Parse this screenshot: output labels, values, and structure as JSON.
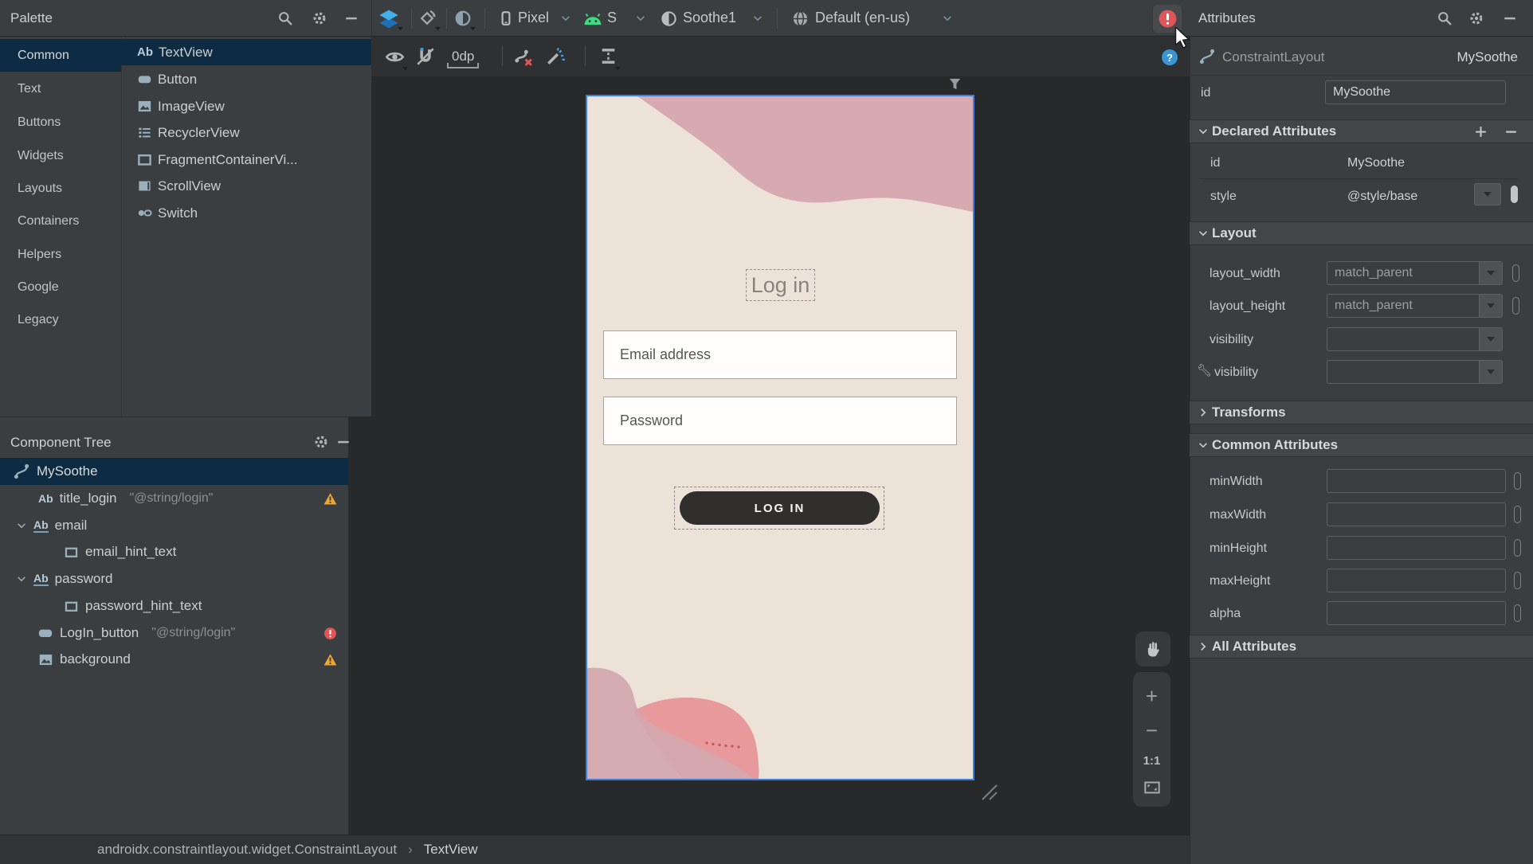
{
  "palette": {
    "title": "Palette",
    "categories": [
      {
        "label": "Common",
        "selected": true
      },
      {
        "label": "Text"
      },
      {
        "label": "Buttons"
      },
      {
        "label": "Widgets"
      },
      {
        "label": "Layouts"
      },
      {
        "label": "Containers"
      },
      {
        "label": "Helpers"
      },
      {
        "label": "Google"
      },
      {
        "label": "Legacy"
      }
    ],
    "widgets": [
      {
        "label": "TextView",
        "icon": "textview-ab-icon",
        "selected": true
      },
      {
        "label": "Button",
        "icon": "button-icon"
      },
      {
        "label": "ImageView",
        "icon": "image-icon"
      },
      {
        "label": "RecyclerView",
        "icon": "list-icon"
      },
      {
        "label": "FragmentContainerVi...",
        "icon": "fragment-icon"
      },
      {
        "label": "ScrollView",
        "icon": "scroll-icon"
      },
      {
        "label": "Switch",
        "icon": "switch-icon"
      }
    ]
  },
  "toolbar": {
    "device": "Pixel",
    "api": "S",
    "theme": "Soothe1",
    "locale": "Default (en-us)",
    "margin": "0dp"
  },
  "component_tree": {
    "title": "Component Tree",
    "items": [
      {
        "label": "MySoothe",
        "icon": "constraint-icon",
        "selected": true
      },
      {
        "label": "title_login",
        "value": "\"@string/login\"",
        "icon": "ab-icon",
        "badge": "warning"
      },
      {
        "label": "email",
        "icon": "ab-underline-icon",
        "expanded": true
      },
      {
        "label": "email_hint_text",
        "icon": "frame-icon"
      },
      {
        "label": "password",
        "icon": "ab-underline-icon",
        "expanded": true
      },
      {
        "label": "password_hint_text",
        "icon": "frame-icon"
      },
      {
        "label": "LogIn_button",
        "value": "\"@string/login\"",
        "icon": "button-icon",
        "badge": "error"
      },
      {
        "label": "background",
        "icon": "image-icon",
        "badge": "warning"
      }
    ]
  },
  "canvas": {
    "title_text": "Log in",
    "email_hint": "Email address",
    "password_hint": "Password",
    "button_label": "LOG IN",
    "colors": {
      "screen_bg": "#ece2d8",
      "blob_pink": "#d7a9b0",
      "blob_rose": "#e8999b",
      "button_dark": "#302f2d",
      "selection_blue": "#3c7ee2"
    }
  },
  "zoom_controls": {
    "zoom_in": "+",
    "zoom_out": "−",
    "actual_size": "1:1"
  },
  "attributes": {
    "title": "Attributes",
    "component_type": "ConstraintLayout",
    "component_id": "MySoothe",
    "id_label": "id",
    "id_value": "MySoothe",
    "declared": {
      "title": "Declared Attributes",
      "rows": [
        {
          "name": "id",
          "value": "MySoothe"
        },
        {
          "name": "style",
          "value": "@style/base"
        }
      ]
    },
    "layout": {
      "title": "Layout",
      "rows": [
        {
          "name": "layout_width",
          "value": "match_parent"
        },
        {
          "name": "layout_height",
          "value": "match_parent"
        },
        {
          "name": "visibility",
          "value": ""
        },
        {
          "name": "visibility",
          "value": "",
          "tools": true
        }
      ]
    },
    "transforms_title": "Transforms",
    "common": {
      "title": "Common Attributes",
      "rows": [
        {
          "name": "minWidth"
        },
        {
          "name": "maxWidth"
        },
        {
          "name": "minHeight"
        },
        {
          "name": "maxHeight"
        },
        {
          "name": "alpha"
        }
      ]
    },
    "all_title": "All Attributes"
  },
  "breadcrumb": {
    "path": "androidx.constraintlayout.widget.ConstraintLayout",
    "separator": "›",
    "current": "TextView"
  },
  "status_colors": {
    "error_red": "#e05558",
    "warning_orange": "#f0a732",
    "android_green": "#3ddc84"
  }
}
